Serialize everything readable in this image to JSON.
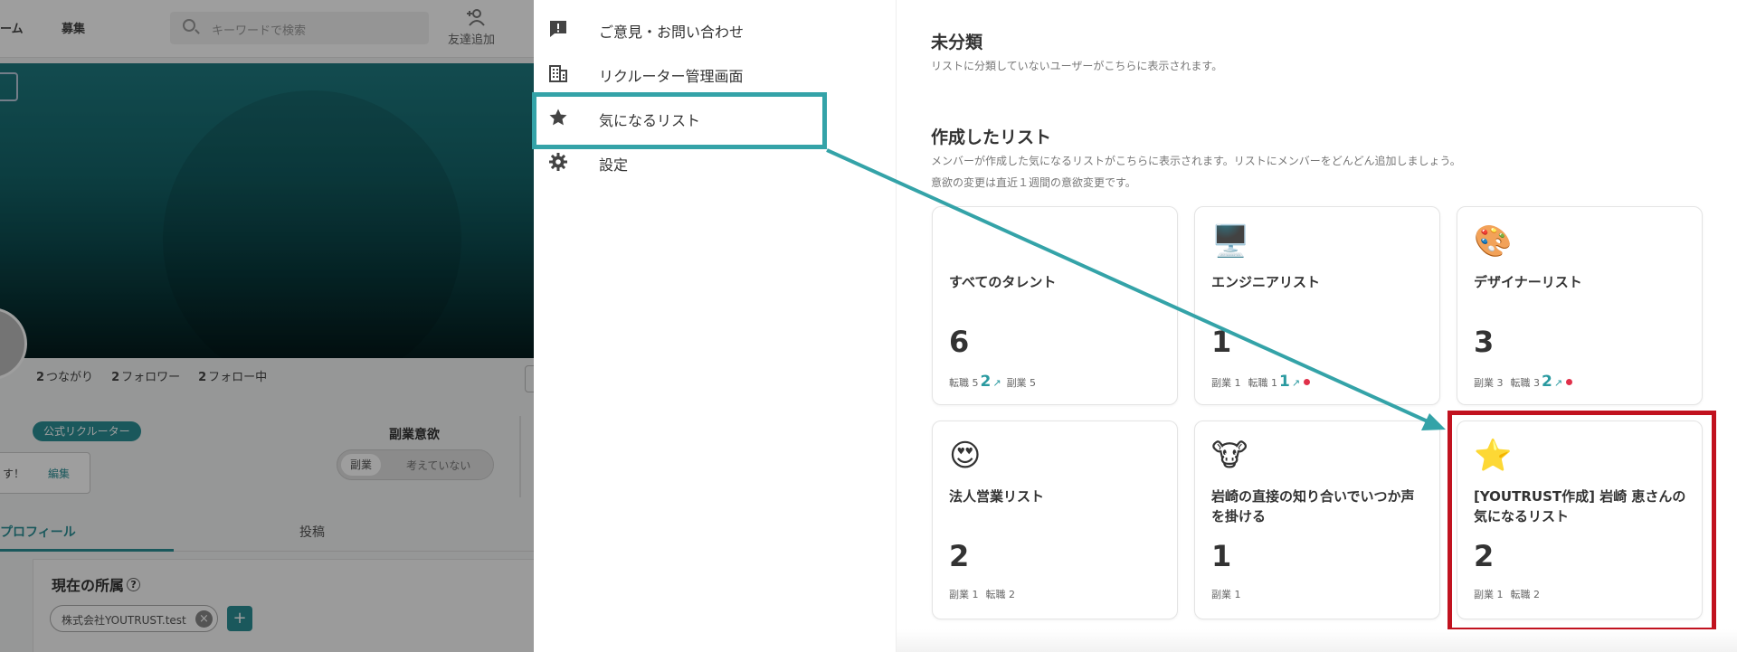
{
  "left_panel": {
    "nav_items": [
      "ーム",
      "募集"
    ],
    "search_placeholder": "キーワードで検索",
    "friend_add_label": "友達追加",
    "stats": [
      {
        "count": "2",
        "label": "つながり"
      },
      {
        "count": "2",
        "label": "フォロワー"
      },
      {
        "count": "2",
        "label": "フォロー中"
      }
    ],
    "recruiter_badge": "公式リクルーター",
    "intro_text": "す！",
    "edit_label": "編集",
    "side_job_title": "副業意欲",
    "side_job_toggle": {
      "selected": "副業",
      "other": "考えていない"
    },
    "tab_profile": "プロフィール",
    "tab_posts": "投稿",
    "affiliation_title": "現在の所属",
    "affiliation_help": "?",
    "affiliation_chip": "株式会社YOUTRUST.test",
    "affiliation_add": "+"
  },
  "menu": {
    "items": [
      {
        "label": "ご意見・お問い合わせ",
        "icon": "feedback-icon"
      },
      {
        "label": "リクルーター管理画面",
        "icon": "building-icon"
      },
      {
        "label": "気になるリスト",
        "icon": "star-icon"
      },
      {
        "label": "設定",
        "icon": "gear-icon"
      }
    ]
  },
  "content": {
    "uncategorized": {
      "title": "未分類",
      "desc": "リストに分類していないユーザーがこちらに表示されます。"
    },
    "created": {
      "title": "作成したリスト",
      "desc1": "メンバーが作成した気になるリストがこちらに表示されます。リストにメンバーをどんどん追加しましょう。",
      "desc2": "意欲の変更は直近１週間の意欲変更です。"
    },
    "cards": [
      {
        "emoji": "",
        "name": "すべてのタレント",
        "count": "6",
        "meta": [
          {
            "text": "転職 5"
          },
          {
            "up": "2",
            "arrow": "↗"
          },
          {
            "text": "副業 5"
          }
        ]
      },
      {
        "emoji": "🖥️",
        "name": "エンジニアリスト",
        "count": "1",
        "meta": [
          {
            "text": "副業 1"
          },
          {
            "text": "転職 1"
          },
          {
            "up": "1",
            "arrow": "↗",
            "dot": true
          }
        ]
      },
      {
        "emoji": "🎨",
        "name": "デザイナーリスト",
        "count": "3",
        "meta": [
          {
            "text": "副業 3"
          },
          {
            "text": "転職 3"
          },
          {
            "up": "2",
            "arrow": "↗",
            "dot": true
          }
        ]
      },
      {
        "emoji": "😍",
        "name": "法人営業リスト",
        "count": "2",
        "meta": [
          {
            "text": "副業 1"
          },
          {
            "text": "転職 2"
          }
        ]
      },
      {
        "emoji": "🐮",
        "name": "岩崎の直接の知り合いでいつか声を掛ける",
        "count": "1",
        "meta": [
          {
            "text": "副業 1"
          }
        ]
      },
      {
        "emoji": "⭐",
        "name": "[YOUTRUST作成] 岩崎 恵さんの気になるリスト",
        "count": "2",
        "meta": [
          {
            "text": "副業 1"
          },
          {
            "text": "転職 2"
          }
        ]
      }
    ]
  },
  "colors": {
    "accent_teal": "#2a9aa0",
    "menu_highlight": "#34a3a8",
    "card_highlight": "#c1121f",
    "new_dot": "#e0304a"
  }
}
